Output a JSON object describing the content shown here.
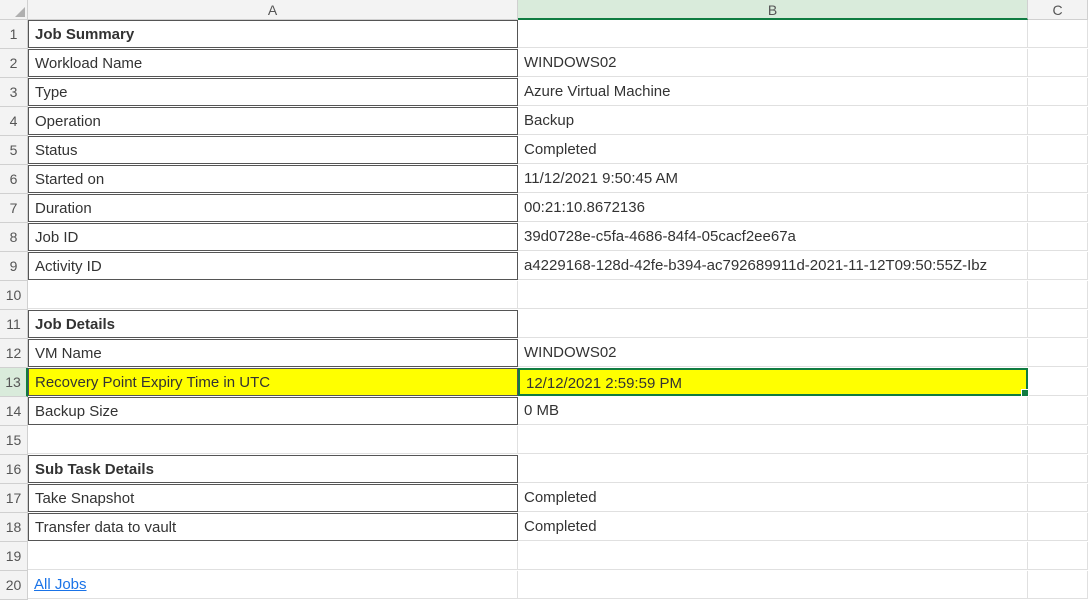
{
  "columns": {
    "a": "A",
    "b": "B",
    "c": "C"
  },
  "rows": {
    "1": {
      "a": "Job Summary",
      "b": ""
    },
    "2": {
      "a": "Workload Name",
      "b": "WINDOWS02"
    },
    "3": {
      "a": "Type",
      "b": "Azure Virtual Machine"
    },
    "4": {
      "a": "Operation",
      "b": "Backup"
    },
    "5": {
      "a": "Status",
      "b": "Completed"
    },
    "6": {
      "a": "Started on",
      "b": "11/12/2021 9:50:45 AM"
    },
    "7": {
      "a": "Duration",
      "b": "00:21:10.8672136"
    },
    "8": {
      "a": "Job ID",
      "b": "39d0728e-c5fa-4686-84f4-05cacf2ee67a"
    },
    "9": {
      "a": "Activity ID",
      "b": "a4229168-128d-42fe-b394-ac792689911d-2021-11-12T09:50:55Z-Ibz"
    },
    "10": {
      "a": "",
      "b": ""
    },
    "11": {
      "a": "Job Details",
      "b": ""
    },
    "12": {
      "a": "VM Name",
      "b": "WINDOWS02"
    },
    "13": {
      "a": "Recovery Point Expiry Time in UTC",
      "b": "12/12/2021 2:59:59 PM"
    },
    "14": {
      "a": "Backup Size",
      "b": "0 MB"
    },
    "15": {
      "a": "",
      "b": ""
    },
    "16": {
      "a": "Sub Task Details",
      "b": ""
    },
    "17": {
      "a": "Take Snapshot",
      "b": "Completed"
    },
    "18": {
      "a": "Transfer data to vault",
      "b": "Completed"
    },
    "19": {
      "a": "",
      "b": ""
    },
    "20": {
      "a": "All Jobs",
      "b": ""
    }
  },
  "row_numbers": [
    "1",
    "2",
    "3",
    "4",
    "5",
    "6",
    "7",
    "8",
    "9",
    "10",
    "11",
    "12",
    "13",
    "14",
    "15",
    "16",
    "17",
    "18",
    "19",
    "20"
  ]
}
